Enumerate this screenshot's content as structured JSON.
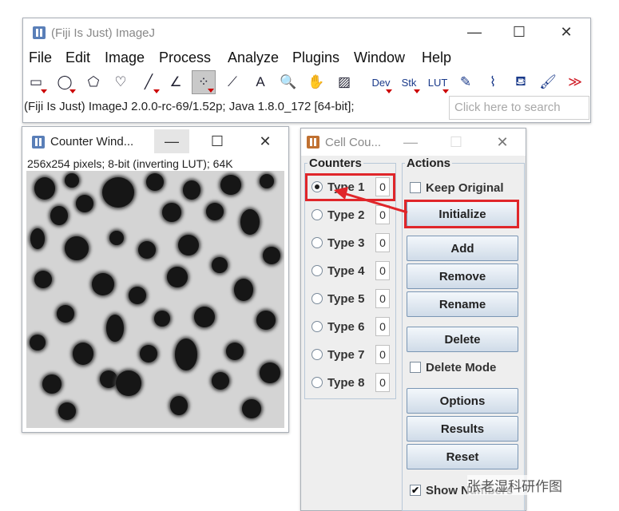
{
  "main_window": {
    "title": "(Fiji Is Just) ImageJ",
    "controls": {
      "minimize": "—",
      "maximize": "☐",
      "close": "✕"
    },
    "menu": [
      "File",
      "Edit",
      "Image",
      "Process",
      "Analyze",
      "Plugins",
      "Window",
      "Help"
    ],
    "tools": [
      {
        "name": "rectangle-tool",
        "glyph": "▭"
      },
      {
        "name": "oval-tool",
        "glyph": "◯"
      },
      {
        "name": "polygon-tool",
        "glyph": "⬠"
      },
      {
        "name": "freehand-tool",
        "glyph": "♡"
      },
      {
        "name": "line-tool",
        "glyph": "╱"
      },
      {
        "name": "angle-tool",
        "glyph": "∠"
      },
      {
        "name": "multipoint-tool",
        "glyph": "⁘"
      },
      {
        "name": "wand-tool",
        "glyph": "⟋"
      },
      {
        "name": "text-tool",
        "glyph": "A"
      },
      {
        "name": "magnifier-tool",
        "glyph": "🔍"
      },
      {
        "name": "hand-tool",
        "glyph": "✋"
      },
      {
        "name": "color-picker-tool",
        "glyph": "▨"
      },
      {
        "name": "dev-tool",
        "glyph": "Dev"
      },
      {
        "name": "stk-tool",
        "glyph": "Stk"
      },
      {
        "name": "lut-tool",
        "glyph": "LUT"
      },
      {
        "name": "pencil-tool",
        "glyph": "✎"
      },
      {
        "name": "brush-tool",
        "glyph": "⌇"
      },
      {
        "name": "flood-fill-tool",
        "glyph": "⛾"
      },
      {
        "name": "paintbrush-tool",
        "glyph": "🖌"
      },
      {
        "name": "more-tools",
        "glyph": "≫"
      }
    ],
    "status": "(Fiji Is Just) ImageJ 2.0.0-rc-69/1.52p; Java 1.8.0_172 [64-bit];",
    "search_placeholder": "Click here to search"
  },
  "counter_window": {
    "title": "Counter Wind...",
    "controls": {
      "minimize": "—",
      "maximize": "☐",
      "close": "✕"
    },
    "info": "256x254 pixels; 8-bit (inverting LUT); 64K"
  },
  "cell_counter": {
    "title": "Cell Cou...",
    "controls": {
      "minimize": "—",
      "maximize": "☐",
      "close": "✕"
    },
    "counters_title": "Counters",
    "actions_title": "Actions",
    "types": [
      {
        "label": "Type 1",
        "count": "0"
      },
      {
        "label": "Type 2",
        "count": "0"
      },
      {
        "label": "Type 3",
        "count": "0"
      },
      {
        "label": "Type 4",
        "count": "0"
      },
      {
        "label": "Type 5",
        "count": "0"
      },
      {
        "label": "Type 6",
        "count": "0"
      },
      {
        "label": "Type 7",
        "count": "0"
      },
      {
        "label": "Type 8",
        "count": "0"
      }
    ],
    "keep_original": "Keep Original",
    "buttons": {
      "initialize": "Initialize",
      "add": "Add",
      "remove": "Remove",
      "rename": "Rename",
      "delete": "Delete",
      "options": "Options",
      "results": "Results",
      "reset": "Reset"
    },
    "delete_mode": "Delete Mode",
    "show_numbers": "Show Numbers"
  },
  "watermark": "张老湿科研作图",
  "colors": {
    "highlight": "#e0262a",
    "button": "#cfdbe8",
    "panel": "#eeeeee"
  }
}
